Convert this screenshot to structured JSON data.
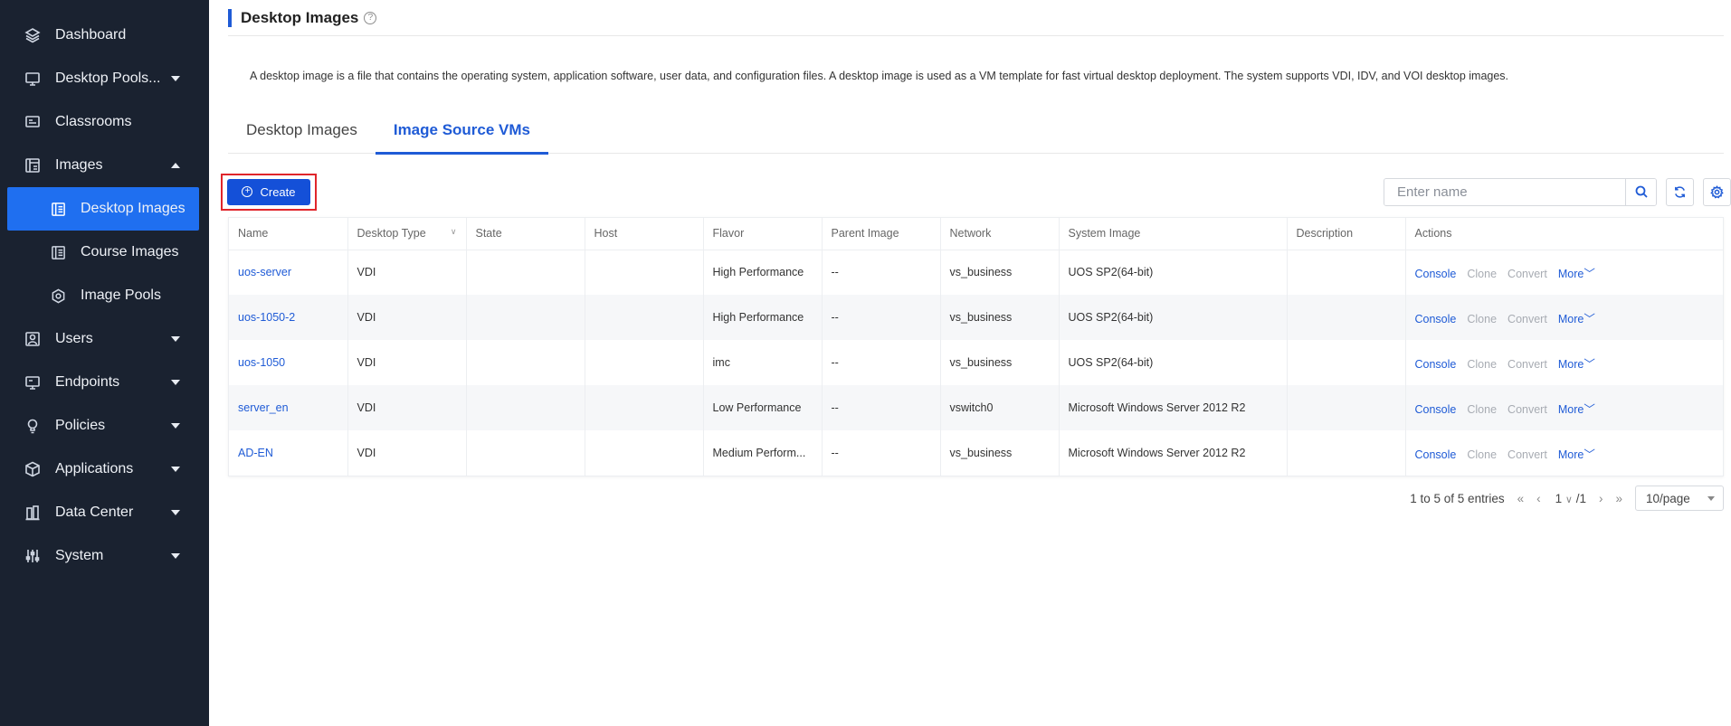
{
  "sidebar": {
    "items": [
      {
        "label": "Dashboard",
        "icon": "layers-icon"
      },
      {
        "label": "Desktop Pools...",
        "icon": "desktop-icon"
      },
      {
        "label": "Classrooms",
        "icon": "classroom-icon"
      },
      {
        "label": "Images",
        "icon": "images-icon"
      },
      {
        "label": "Desktop Images",
        "icon": "image-icon"
      },
      {
        "label": "Course Images",
        "icon": "image-icon"
      },
      {
        "label": "Image Pools",
        "icon": "hexagon-icon"
      },
      {
        "label": "Users",
        "icon": "user-icon"
      },
      {
        "label": "Endpoints",
        "icon": "monitor-icon"
      },
      {
        "label": "Policies",
        "icon": "bulb-icon"
      },
      {
        "label": "Applications",
        "icon": "cube-icon"
      },
      {
        "label": "Data Center",
        "icon": "building-icon"
      },
      {
        "label": "System",
        "icon": "sliders-icon"
      }
    ]
  },
  "header": {
    "title": "Desktop Images",
    "help": "?"
  },
  "description": "A desktop image is a file that contains the operating system, application software, user data, and configuration files. A desktop image is used as a VM template for fast virtual desktop deployment. The system supports VDI, IDV, and VOI desktop images.",
  "tabs": [
    {
      "label": "Desktop Images"
    },
    {
      "label": "Image Source VMs"
    }
  ],
  "toolbar": {
    "create_label": "Create",
    "search_placeholder": "Enter name"
  },
  "table": {
    "columns": [
      "Name",
      "Desktop Type",
      "State",
      "Host",
      "Flavor",
      "Parent Image",
      "Network",
      "System Image",
      "Description",
      "Actions"
    ],
    "rows": [
      {
        "name": "uos-server",
        "type": "VDI",
        "state": "",
        "host": "",
        "flavor": "High Performance",
        "parent": "--",
        "network": "vs_business",
        "system": "UOS SP2(64-bit)",
        "desc": ""
      },
      {
        "name": "uos-1050-2",
        "type": "VDI",
        "state": "",
        "host": "",
        "flavor": "High Performance",
        "parent": "--",
        "network": "vs_business",
        "system": "UOS SP2(64-bit)",
        "desc": ""
      },
      {
        "name": "uos-1050",
        "type": "VDI",
        "state": "",
        "host": "",
        "flavor": "imc",
        "parent": "--",
        "network": "vs_business",
        "system": "UOS SP2(64-bit)",
        "desc": ""
      },
      {
        "name": "server_en",
        "type": "VDI",
        "state": "",
        "host": "",
        "flavor": "Low Performance",
        "parent": "--",
        "network": "vswitch0",
        "system": "Microsoft Windows Server 2012 R2",
        "desc": ""
      },
      {
        "name": "AD-EN",
        "type": "VDI",
        "state": "",
        "host": "",
        "flavor": "Medium Perform...",
        "parent": "--",
        "network": "vs_business",
        "system": "Microsoft Windows Server 2012 R2",
        "desc": ""
      }
    ],
    "actions": {
      "console": "Console",
      "clone": "Clone",
      "convert": "Convert",
      "more": "More"
    }
  },
  "pager": {
    "summary": "1 to 5 of 5 entries",
    "first": "«",
    "prev": "‹",
    "page": "1",
    "total": "/1",
    "next": "›",
    "last": "»",
    "page_size": "10/page"
  },
  "colors": {
    "accent": "#1f5bd6",
    "sidebar_bg": "#1a2230",
    "active_nav": "#1f6ff0",
    "highlight_border": "#e0252b"
  }
}
